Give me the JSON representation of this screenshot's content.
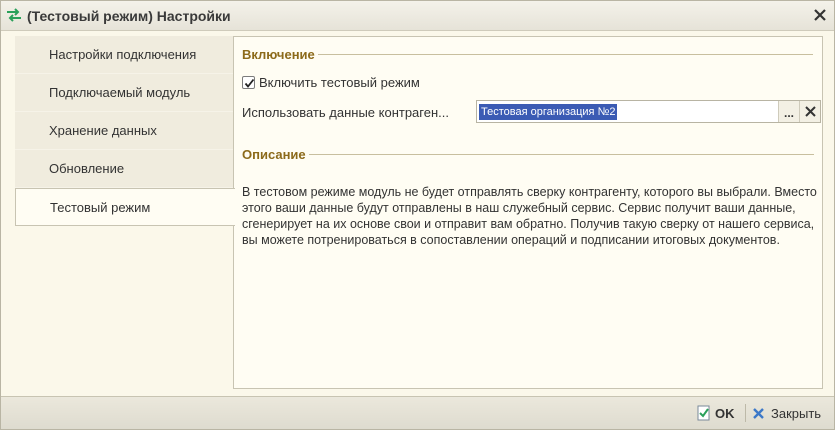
{
  "window": {
    "title": "(Тестовый режим) Настройки",
    "title_icon": "swap-arrows-icon",
    "close_icon": "close-icon"
  },
  "tabs": [
    {
      "label": "Настройки подключения",
      "active": false
    },
    {
      "label": "Подключаемый модуль",
      "active": false
    },
    {
      "label": "Хранение данных",
      "active": false
    },
    {
      "label": "Обновление",
      "active": false
    },
    {
      "label": "Тестовый режим",
      "active": true
    }
  ],
  "enable_section": {
    "heading": "Включение",
    "checkbox_label": "Включить тестовый режим",
    "checked": true,
    "field_label": "Использовать данные контраген...",
    "field_value": "Тестовая организация №2",
    "select_button": "...",
    "clear_icon": "clear-x-icon"
  },
  "description_section": {
    "heading": "Описание",
    "text": "В тестовом режиме модуль не будет отправлять сверку контрагенту, которого вы выбрали. Вместо этого ваши данные будут отправлены в наш служебный сервис. Сервис получит ваши данные, сгенерирует на их основе свои и отправит вам обратно. Получив такую сверку от нашего сервиса, вы можете потренироваться в сопоставлении операций и подписании итоговых документов."
  },
  "footer": {
    "ok_label": "OK",
    "ok_icon": "document-check-icon",
    "close_label": "Закрыть",
    "close_icon": "blue-x-icon"
  },
  "colors": {
    "accent": "#8c6a1a",
    "selection": "#3b5bb4",
    "background": "#fbf8ea"
  }
}
